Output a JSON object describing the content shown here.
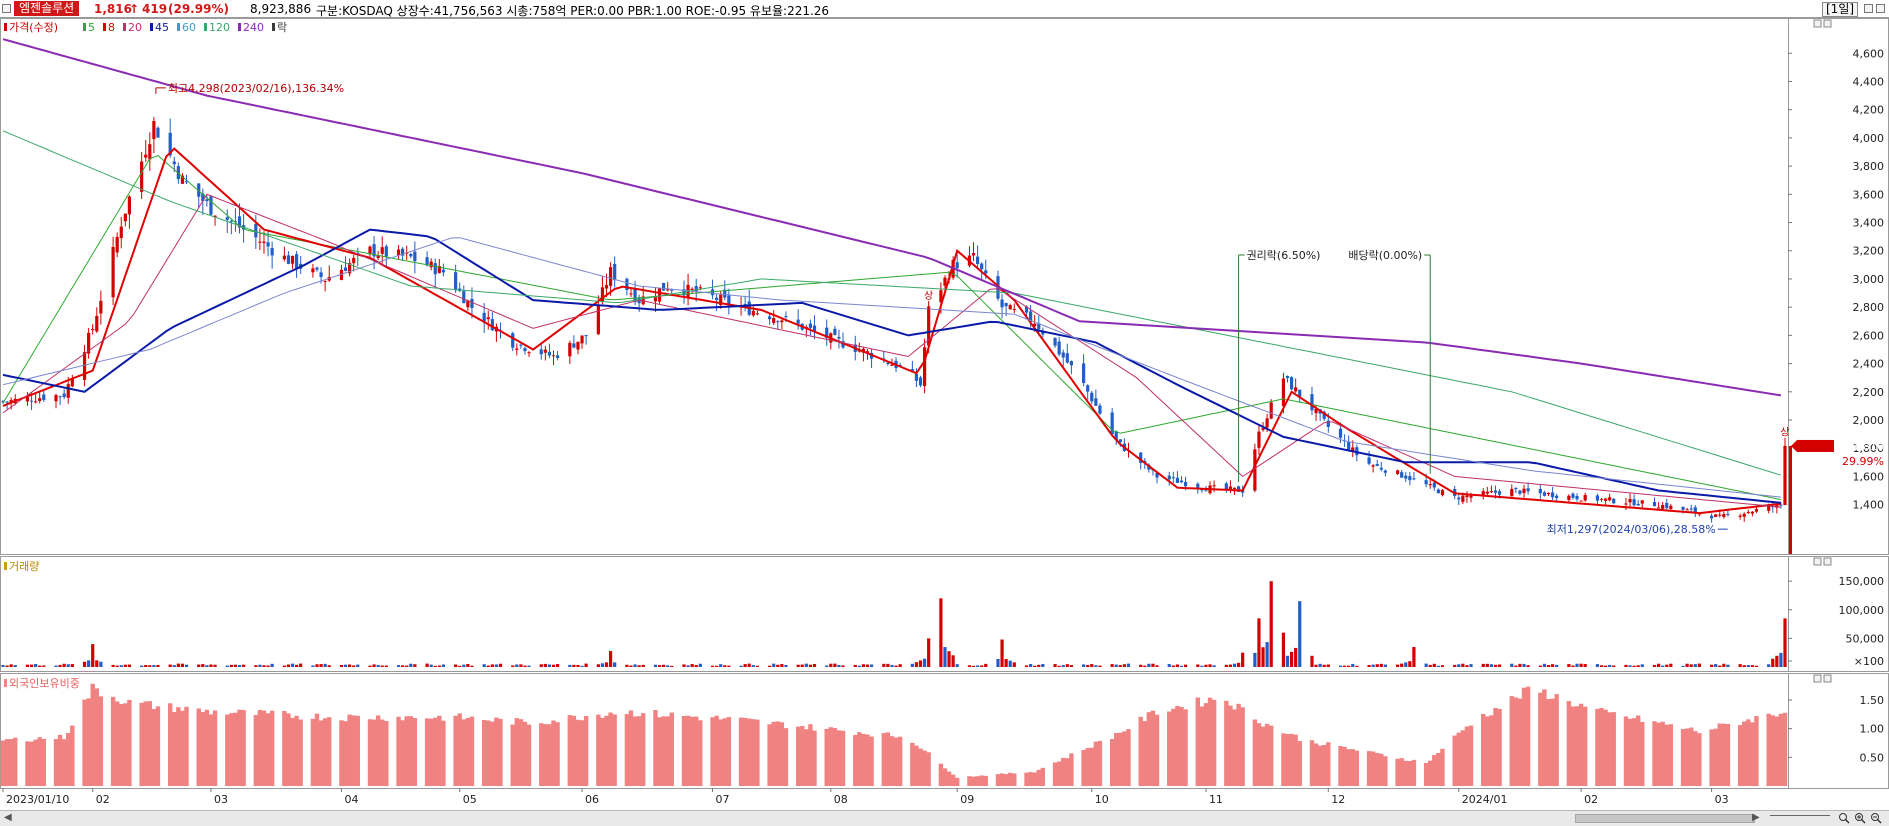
{
  "header": {
    "stock_name": "엠젠솔루션",
    "price": "1,816",
    "arrow": "↑",
    "change": "419",
    "change_pct": "(29.99%)",
    "volume": "8,923,886",
    "info": "구분:KOSDAQ 상장수:41,756,563 시총:758억 PER:0.00 PBR:1.00 ROE:-0.95 유보율:221.26",
    "period": "[1일]"
  },
  "colors": {
    "up": "#d40000",
    "down": "#1f5fc7",
    "ma5": "#2ea82e",
    "ma8": "#e00000",
    "ma20": "#c0306a",
    "ma45": "#0a1aa8",
    "ma60": "#7a86d0",
    "ma120": "#3aa86a",
    "ma240": "#8a2bb4",
    "foreign": "#f08282"
  },
  "price_panel": {
    "legend": [
      {
        "label": "가격(수정)",
        "color": "#d40000"
      },
      {
        "label": "5",
        "color": "#2ea82e"
      },
      {
        "label": "8",
        "color": "#e00000"
      },
      {
        "label": "20",
        "color": "#c0306a"
      },
      {
        "label": "45",
        "color": "#0a1aa8"
      },
      {
        "label": "60",
        "color": "#3aa0c8"
      },
      {
        "label": "120",
        "color": "#3aa86a"
      },
      {
        "label": "240",
        "color": "#8a2bb4"
      },
      {
        "label": "락",
        "color": "#3a3a3a"
      }
    ],
    "high_note": "최고4,298(2023/02/16),136.34%",
    "low_note": "최저1,297(2024/03/06),28.58%",
    "rights_note": "권리락(6.50%)",
    "dividend_note": "배당락(0.00%)",
    "up_limit_label": "상",
    "price_tag": "1,816",
    "pct_tag": "29.99%"
  },
  "volume_panel": {
    "title": "거래량"
  },
  "foreign_panel": {
    "title": "외국인보유비중"
  },
  "x_axis": [
    "2023/01/10",
    "02",
    "03",
    "04",
    "05",
    "06",
    "07",
    "08",
    "09",
    "10",
    "11",
    "12",
    "2024/01",
    "02",
    "03"
  ],
  "chart_data": [
    {
      "type": "candlestick",
      "title": "가격(수정)",
      "yticks": [
        1400,
        1600,
        1800,
        2000,
        2200,
        2400,
        2600,
        2800,
        3000,
        3200,
        3400,
        3600,
        3800,
        4000,
        4200,
        4400,
        4600
      ],
      "ylim": [
        1050,
        4850
      ],
      "x_range": [
        "2023/01/10",
        "2024/03/22"
      ],
      "close_path_waypoints": [
        [
          "2023/01/10",
          2130
        ],
        [
          "2023/01/25",
          2180
        ],
        [
          "2023/02/01",
          2650
        ],
        [
          "2023/02/08",
          3400
        ],
        [
          "2023/02/16",
          4100
        ],
        [
          "2023/02/23",
          3700
        ],
        [
          "2023/03/02",
          3500
        ],
        [
          "2023/03/10",
          3350
        ],
        [
          "2023/03/20",
          3150
        ],
        [
          "2023/03/30",
          3000
        ],
        [
          "2023/04/10",
          3200
        ],
        [
          "2023/04/20",
          3150
        ],
        [
          "2023/04/28",
          3050
        ],
        [
          "2023/05/05",
          2800
        ],
        [
          "2023/05/15",
          2550
        ],
        [
          "2023/05/25",
          2450
        ],
        [
          "2023/06/02",
          2600
        ],
        [
          "2023/06/08",
          3050
        ],
        [
          "2023/06/15",
          2850
        ],
        [
          "2023/06/22",
          2950
        ],
        [
          "2023/06/30",
          2900
        ],
        [
          "2023/07/10",
          2800
        ],
        [
          "2023/07/20",
          2720
        ],
        [
          "2023/07/30",
          2600
        ],
        [
          "2023/08/08",
          2500
        ],
        [
          "2023/08/20",
          2350
        ],
        [
          "2023/08/23",
          2250
        ],
        [
          "2023/08/25",
          2780
        ],
        [
          "2023/08/31",
          3100
        ],
        [
          "2023/09/05",
          3150
        ],
        [
          "2023/09/12",
          2800
        ],
        [
          "2023/09/20",
          2700
        ],
        [
          "2023/10/01",
          2300
        ],
        [
          "2023/10/10",
          1850
        ],
        [
          "2023/10/20",
          1600
        ],
        [
          "2023/11/01",
          1520
        ],
        [
          "2023/11/10",
          1500
        ],
        [
          "2023/11/14",
          1900
        ],
        [
          "2023/11/20",
          2300
        ],
        [
          "2023/11/25",
          2150
        ],
        [
          "2023/12/01",
          1950
        ],
        [
          "2023/12/10",
          1700
        ],
        [
          "2023/12/20",
          1600
        ],
        [
          "2024/01/01",
          1450
        ],
        [
          "2024/01/15",
          1500
        ],
        [
          "2024/02/01",
          1450
        ],
        [
          "2024/02/20",
          1400
        ],
        [
          "2024/03/06",
          1310
        ],
        [
          "2024/03/21",
          1397
        ],
        [
          "2024/03/22",
          1816
        ]
      ],
      "series": [
        {
          "name": "5",
          "waypoints": [
            [
              "2023/01/10",
              2120
            ],
            [
              "2023/02/16",
              3900
            ],
            [
              "2023/03/10",
              3350
            ],
            [
              "2023/06/08",
              2850
            ],
            [
              "2023/08/31",
              3050
            ],
            [
              "2023/10/10",
              1900
            ],
            [
              "2023/11/20",
              2150
            ],
            [
              "2024/03/22",
              1430
            ]
          ]
        },
        {
          "name": "8",
          "waypoints": [
            [
              "2023/01/10",
              2100
            ],
            [
              "2023/02/01",
              2350
            ],
            [
              "2023/02/20",
              3950
            ],
            [
              "2023/03/15",
              3350
            ],
            [
              "2023/04/10",
              3150
            ],
            [
              "2023/05/20",
              2500
            ],
            [
              "2023/06/10",
              2950
            ],
            [
              "2023/07/15",
              2780
            ],
            [
              "2023/08/23",
              2320
            ],
            [
              "2023/09/01",
              3200
            ],
            [
              "2023/09/15",
              2850
            ],
            [
              "2023/10/10",
              1850
            ],
            [
              "2023/10/25",
              1520
            ],
            [
              "2023/11/10",
              1500
            ],
            [
              "2023/11/22",
              2200
            ],
            [
              "2023/12/05",
              1950
            ],
            [
              "2024/01/01",
              1480
            ],
            [
              "2024/03/01",
              1340
            ],
            [
              "2024/03/22",
              1410
            ]
          ]
        },
        {
          "name": "20",
          "waypoints": [
            [
              "2023/01/10",
              2050
            ],
            [
              "2023/02/10",
              2700
            ],
            [
              "2023/03/01",
              3600
            ],
            [
              "2023/04/01",
              3250
            ],
            [
              "2023/05/20",
              2650
            ],
            [
              "2023/06/15",
              2850
            ],
            [
              "2023/08/20",
              2450
            ],
            [
              "2023/09/10",
              2950
            ],
            [
              "2023/10/15",
              2300
            ],
            [
              "2023/11/10",
              1600
            ],
            [
              "2023/12/01",
              2000
            ],
            [
              "2024/01/01",
              1600
            ],
            [
              "2024/03/22",
              1380
            ]
          ]
        },
        {
          "name": "45",
          "waypoints": [
            [
              "2023/01/10",
              2320
            ],
            [
              "2023/01/30",
              2200
            ],
            [
              "2023/02/20",
              2650
            ],
            [
              "2023/03/25",
              3100
            ],
            [
              "2023/04/10",
              3350
            ],
            [
              "2023/04/25",
              3300
            ],
            [
              "2023/05/20",
              2850
            ],
            [
              "2023/06/20",
              2780
            ],
            [
              "2023/07/25",
              2830
            ],
            [
              "2023/08/20",
              2600
            ],
            [
              "2023/09/10",
              2700
            ],
            [
              "2023/10/05",
              2550
            ],
            [
              "2023/10/25",
              2250
            ],
            [
              "2023/11/20",
              1880
            ],
            [
              "2023/12/20",
              1700
            ],
            [
              "2024/01/20",
              1700
            ],
            [
              "2024/02/20",
              1500
            ],
            [
              "2024/03/22",
              1410
            ]
          ]
        },
        {
          "name": "60",
          "waypoints": [
            [
              "2023/01/10",
              2250
            ],
            [
              "2023/02/15",
              2500
            ],
            [
              "2023/03/20",
              2900
            ],
            [
              "2023/05/01",
              3300
            ],
            [
              "2023/06/15",
              2950
            ],
            [
              "2023/07/20",
              2850
            ],
            [
              "2023/09/15",
              2750
            ],
            [
              "2023/10/25",
              2300
            ],
            [
              "2023/12/05",
              1850
            ],
            [
              "2024/01/20",
              1640
            ],
            [
              "2024/03/22",
              1450
            ]
          ]
        },
        {
          "name": "120",
          "waypoints": [
            [
              "2023/01/10",
              4050
            ],
            [
              "2023/02/20",
              3550
            ],
            [
              "2023/04/20",
              2950
            ],
            [
              "2023/06/10",
              2830
            ],
            [
              "2023/07/15",
              3000
            ],
            [
              "2023/09/15",
              2900
            ],
            [
              "2023/11/15",
              2550
            ],
            [
              "2024/01/15",
              2200
            ],
            [
              "2024/03/22",
              1600
            ]
          ]
        },
        {
          "name": "240",
          "waypoints": [
            [
              "2023/01/10",
              4700
            ],
            [
              "2023/03/01",
              4300
            ],
            [
              "2023/06/01",
              3750
            ],
            [
              "2023/08/25",
              3150
            ],
            [
              "2023/10/01",
              2700
            ],
            [
              "2023/11/15",
              2620
            ],
            [
              "2023/12/25",
              2550
            ],
            [
              "2024/02/01",
              2400
            ],
            [
              "2024/03/22",
              2170
            ]
          ]
        }
      ]
    },
    {
      "type": "bar",
      "title": "거래량",
      "yticks": [
        "150,000",
        "100,000",
        "50,000",
        "×100"
      ],
      "ytick_values": [
        150000,
        100000,
        50000,
        0
      ],
      "ylim": [
        0,
        180000
      ],
      "spikes": [
        [
          "2023/02/01",
          40000
        ],
        [
          "2023/06/08",
          28000
        ],
        [
          "2023/08/25",
          50000
        ],
        [
          "2023/08/28",
          120000
        ],
        [
          "2023/09/12",
          48000
        ],
        [
          "2023/11/10",
          25000
        ],
        [
          "2023/11/14",
          85000
        ],
        [
          "2023/11/17",
          150000
        ],
        [
          "2023/11/20",
          60000
        ],
        [
          "2023/11/24",
          115000
        ],
        [
          "2023/12/22",
          35000
        ],
        [
          "2024/03/22",
          85000
        ]
      ],
      "base_level": 4000
    },
    {
      "type": "bar",
      "title": "외국인보유비중",
      "yticks": [
        "1.50",
        "1.00",
        "0.50"
      ],
      "ytick_values": [
        1.5,
        1.0,
        0.5
      ],
      "ylim": [
        0,
        1.9
      ],
      "waypoints": [
        [
          "2023/01/10",
          0.8
        ],
        [
          "2023/01/25",
          0.85
        ],
        [
          "2023/02/01",
          1.7
        ],
        [
          "2023/02/10",
          1.45
        ],
        [
          "2023/03/01",
          1.3
        ],
        [
          "2023/04/01",
          1.2
        ],
        [
          "2023/05/01",
          1.2
        ],
        [
          "2023/05/20",
          1.1
        ],
        [
          "2023/06/10",
          1.3
        ],
        [
          "2023/07/10",
          1.15
        ],
        [
          "2023/08/20",
          0.85
        ],
        [
          "2023/09/01",
          0.15
        ],
        [
          "2023/09/20",
          0.25
        ],
        [
          "2023/10/10",
          0.9
        ],
        [
          "2023/10/20",
          1.3
        ],
        [
          "2023/11/05",
          1.55
        ],
        [
          "2023/11/15",
          1.1
        ],
        [
          "2023/11/25",
          0.8
        ],
        [
          "2023/12/10",
          0.6
        ],
        [
          "2023/12/25",
          0.4
        ],
        [
          "2024/01/05",
          1.1
        ],
        [
          "2024/01/20",
          1.7
        ],
        [
          "2024/02/05",
          1.3
        ],
        [
          "2024/02/20",
          1.1
        ],
        [
          "2024/03/01",
          0.95
        ],
        [
          "2024/03/22",
          1.3
        ]
      ]
    }
  ]
}
